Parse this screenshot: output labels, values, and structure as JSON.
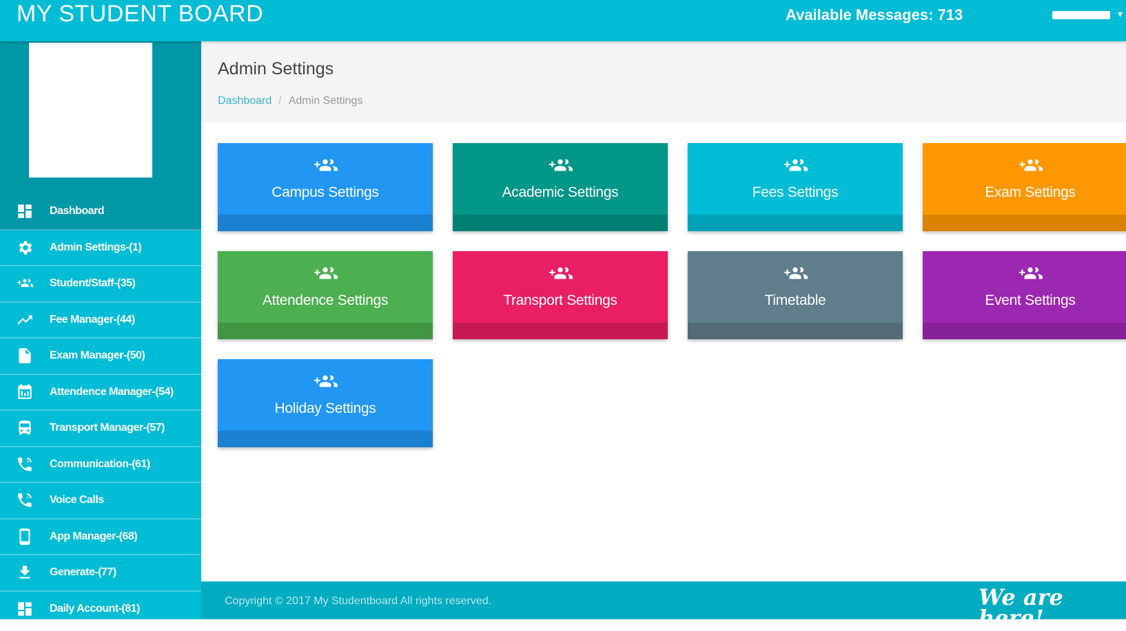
{
  "app": {
    "title": "MY STUDENT BOARD"
  },
  "header": {
    "messages": "Available Messages: 713",
    "user_caret": "▾"
  },
  "sidebar": {
    "items": [
      {
        "label": "Dashboard",
        "icon": "dashboard-icon",
        "active": true
      },
      {
        "label": "Admin Settings-(1)",
        "icon": "gear-icon"
      },
      {
        "label": "Student/Staff-(35)",
        "icon": "group-add-icon"
      },
      {
        "label": "Fee Manager-(44)",
        "icon": "trending-up-icon"
      },
      {
        "label": "Exam Manager-(50)",
        "icon": "document-icon"
      },
      {
        "label": "Attendence Manager-(54)",
        "icon": "calendar-icon"
      },
      {
        "label": "Transport Manager-(57)",
        "icon": "bus-icon"
      },
      {
        "label": "Communication-(61)",
        "icon": "phone-icon"
      },
      {
        "label": "Voice Calls",
        "icon": "phone-icon"
      },
      {
        "label": "App Manager-(68)",
        "icon": "mobile-icon"
      },
      {
        "label": "Generate-(77)",
        "icon": "download-icon"
      },
      {
        "label": "Daily Account-(81)",
        "icon": "dashboard-icon"
      }
    ]
  },
  "page": {
    "title": "Admin Settings",
    "breadcrumb": {
      "home": "Dashboard",
      "separator": "/",
      "current": "Admin Settings"
    }
  },
  "tiles": [
    {
      "label": "Campus Settings",
      "color": "#2196f3",
      "icon": "group-add-icon"
    },
    {
      "label": "Academic Settings",
      "color": "#009688",
      "icon": "group-add-icon"
    },
    {
      "label": "Fees Settings",
      "color": "#00bcd4",
      "icon": "group-add-icon"
    },
    {
      "label": "Exam Settings",
      "color": "#ff9800",
      "icon": "group-add-icon"
    },
    {
      "label": "Attendence Settings",
      "color": "#4caf50",
      "icon": "group-add-icon"
    },
    {
      "label": "Transport Settings",
      "color": "#e91e63",
      "icon": "group-add-icon"
    },
    {
      "label": "Timetable",
      "color": "#607d8b",
      "icon": "group-add-icon"
    },
    {
      "label": "Event Settings",
      "color": "#9c27b0",
      "icon": "group-add-icon"
    },
    {
      "label": "Holiday Settings",
      "color": "#2196f3",
      "icon": "group-add-icon"
    }
  ],
  "footer": {
    "copyright": "Copyright © 2017 My Studentboard All rights reserved.",
    "badge": "We are\nhere!"
  },
  "colors": {
    "accent": "#00bcd4",
    "accent_dark": "#0097a7"
  }
}
